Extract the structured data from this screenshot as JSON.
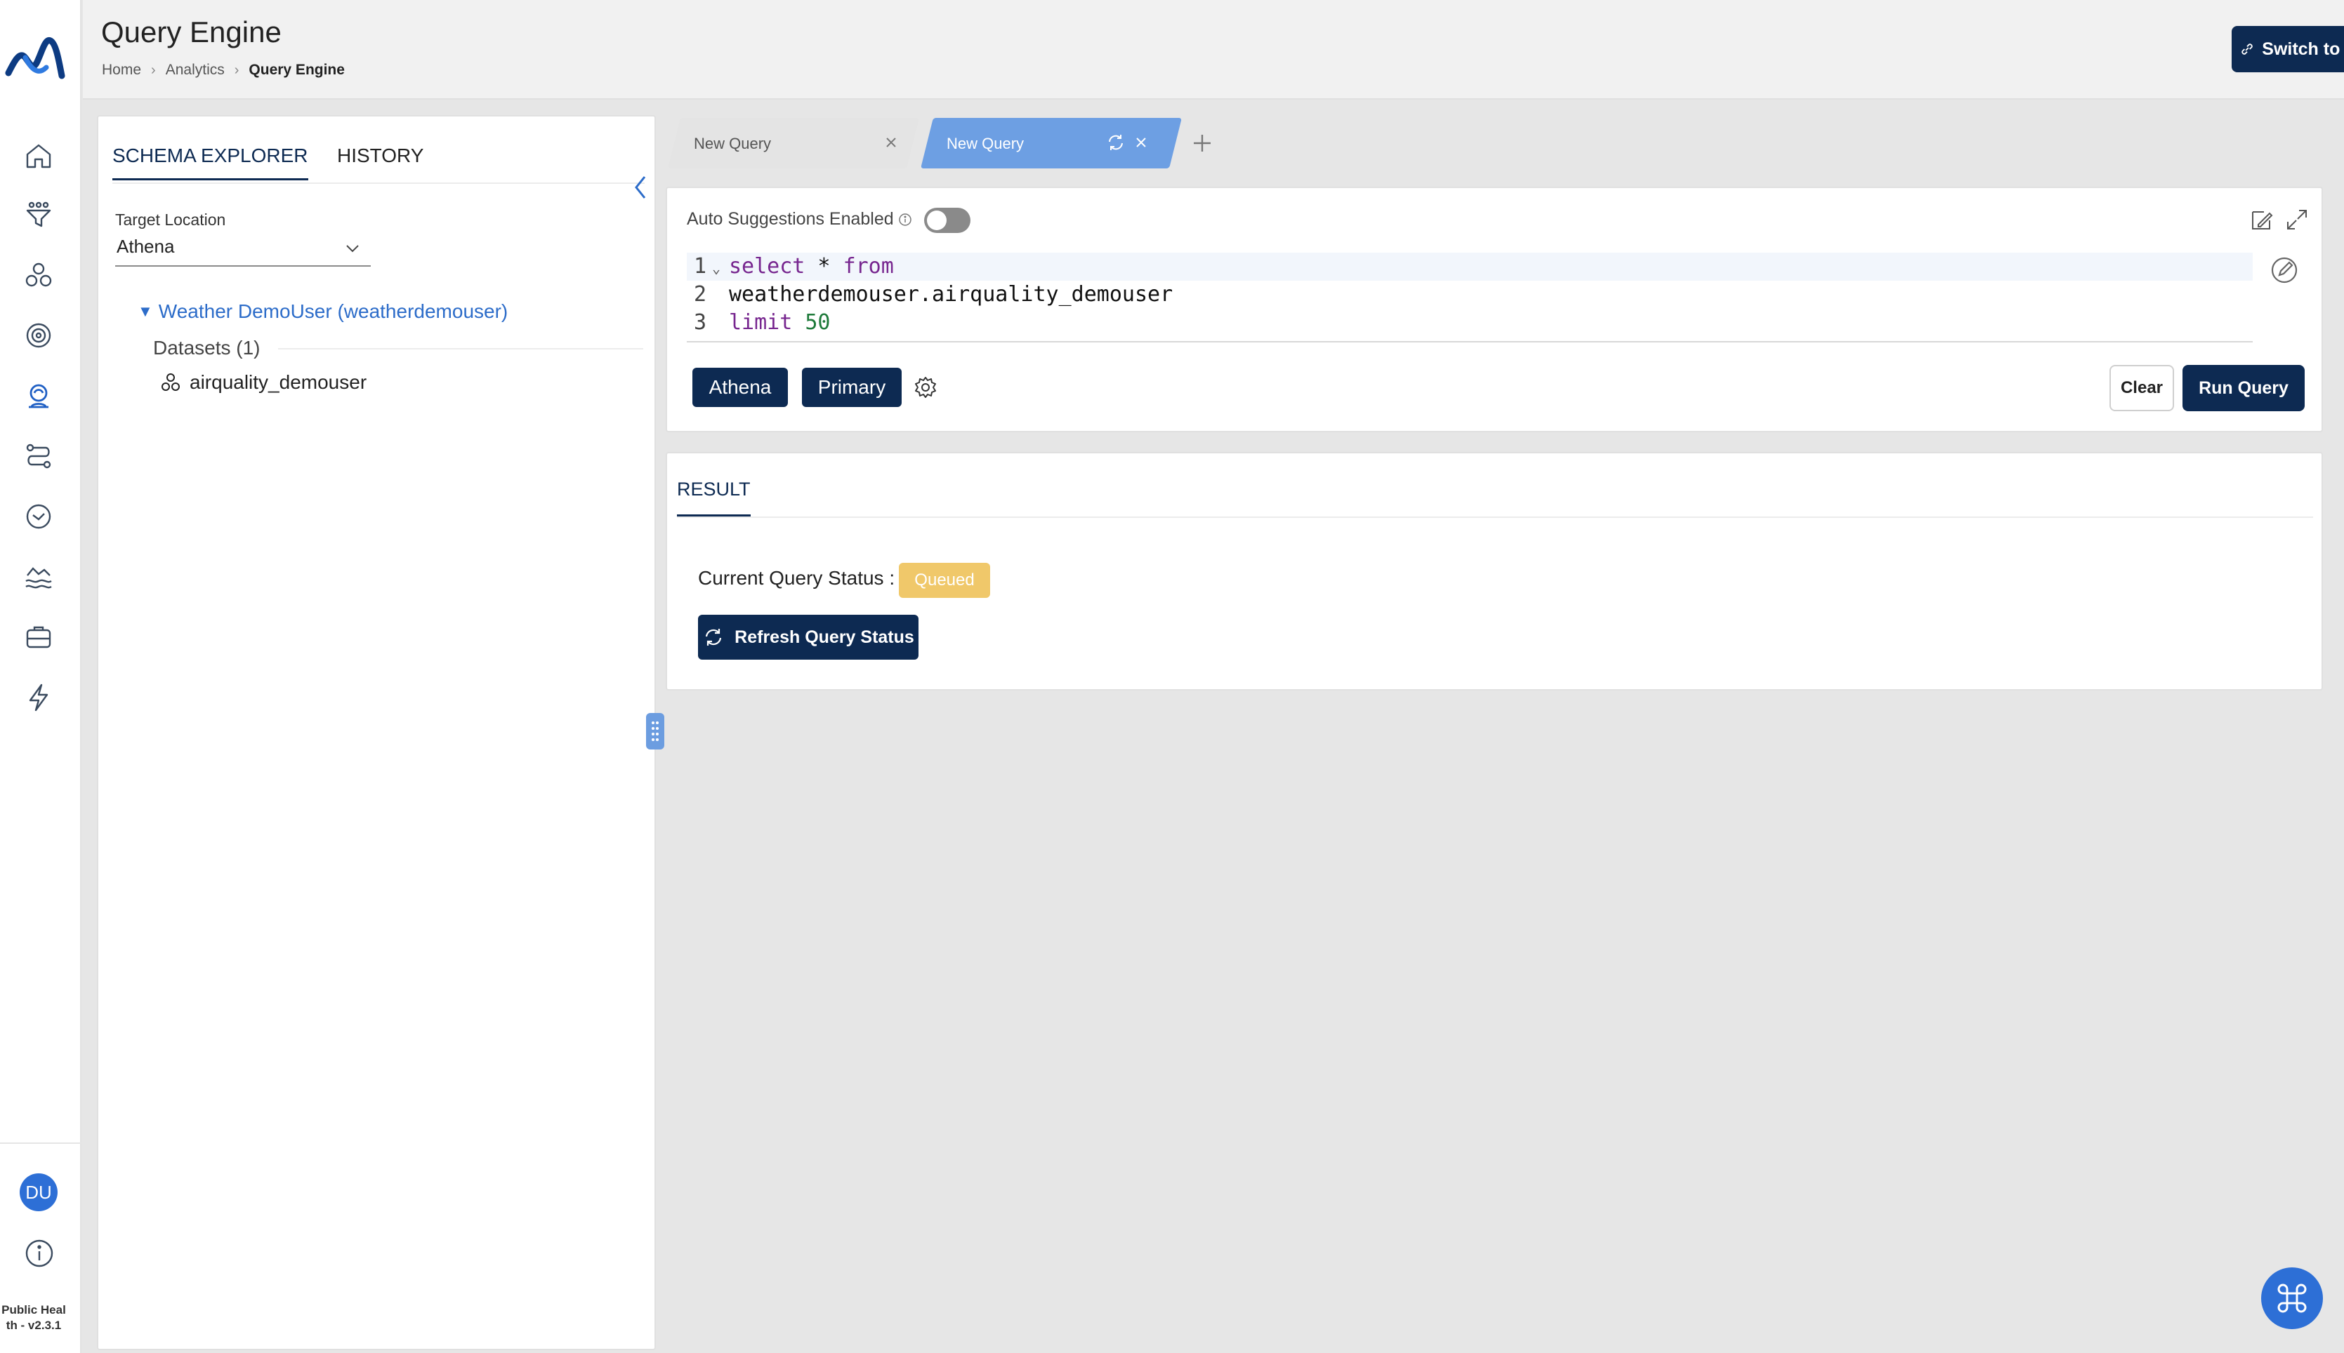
{
  "app": {
    "page_title": "Query Engine",
    "version": "Public Health - v2.3.1",
    "version_line1": "Public Heal",
    "version_line2": "th - v2.3.1",
    "brand_color": "#0d2a52",
    "accent_color": "#2d6fd6"
  },
  "breadcrumb": [
    "Home",
    "Analytics",
    "Query Engine"
  ],
  "header": {
    "switch_label": "Switch to classic"
  },
  "sidebar": {
    "icons": [
      "home-icon",
      "filter-funnel-icon",
      "datasets-icon",
      "target-icon",
      "query-engine-icon",
      "pipeline-icon",
      "clock-icon",
      "data-lake-icon",
      "storage-icon",
      "lightning-icon"
    ],
    "active": "query-engine-icon",
    "avatar_initials": "DU"
  },
  "schema": {
    "tabs": [
      "SCHEMA EXPLORER",
      "HISTORY"
    ],
    "active_tab": "SCHEMA EXPLORER",
    "target_label": "Target Location",
    "target_value": "Athena",
    "tree_root": "Weather DemoUser (weatherdemouser)",
    "datasets_label": "Datasets (1)",
    "datasets": [
      "airquality_demouser"
    ]
  },
  "query_tabs": [
    {
      "label": "New Query",
      "active": false
    },
    {
      "label": "New Query",
      "active": true
    }
  ],
  "editor": {
    "auto_suggestions_label": "Auto Suggestions Enabled",
    "auto_suggestions_on": false,
    "lines": [
      {
        "num": "1",
        "kw1": "select",
        "sym": " * ",
        "kw2": "from"
      },
      {
        "num": "2",
        "text": "weatherdemouser.airquality_demouser"
      },
      {
        "num": "3",
        "kw": "limit",
        "val": "50"
      }
    ],
    "engine_chip": "Athena",
    "workgroup_chip": "Primary",
    "clear_label": "Clear",
    "run_label": "Run Query"
  },
  "result": {
    "tab_label": "RESULT",
    "status_label": "Current Query Status :",
    "status_value": "Queued",
    "status_color": "#f0c86a",
    "refresh_label": "Refresh Query Status"
  }
}
